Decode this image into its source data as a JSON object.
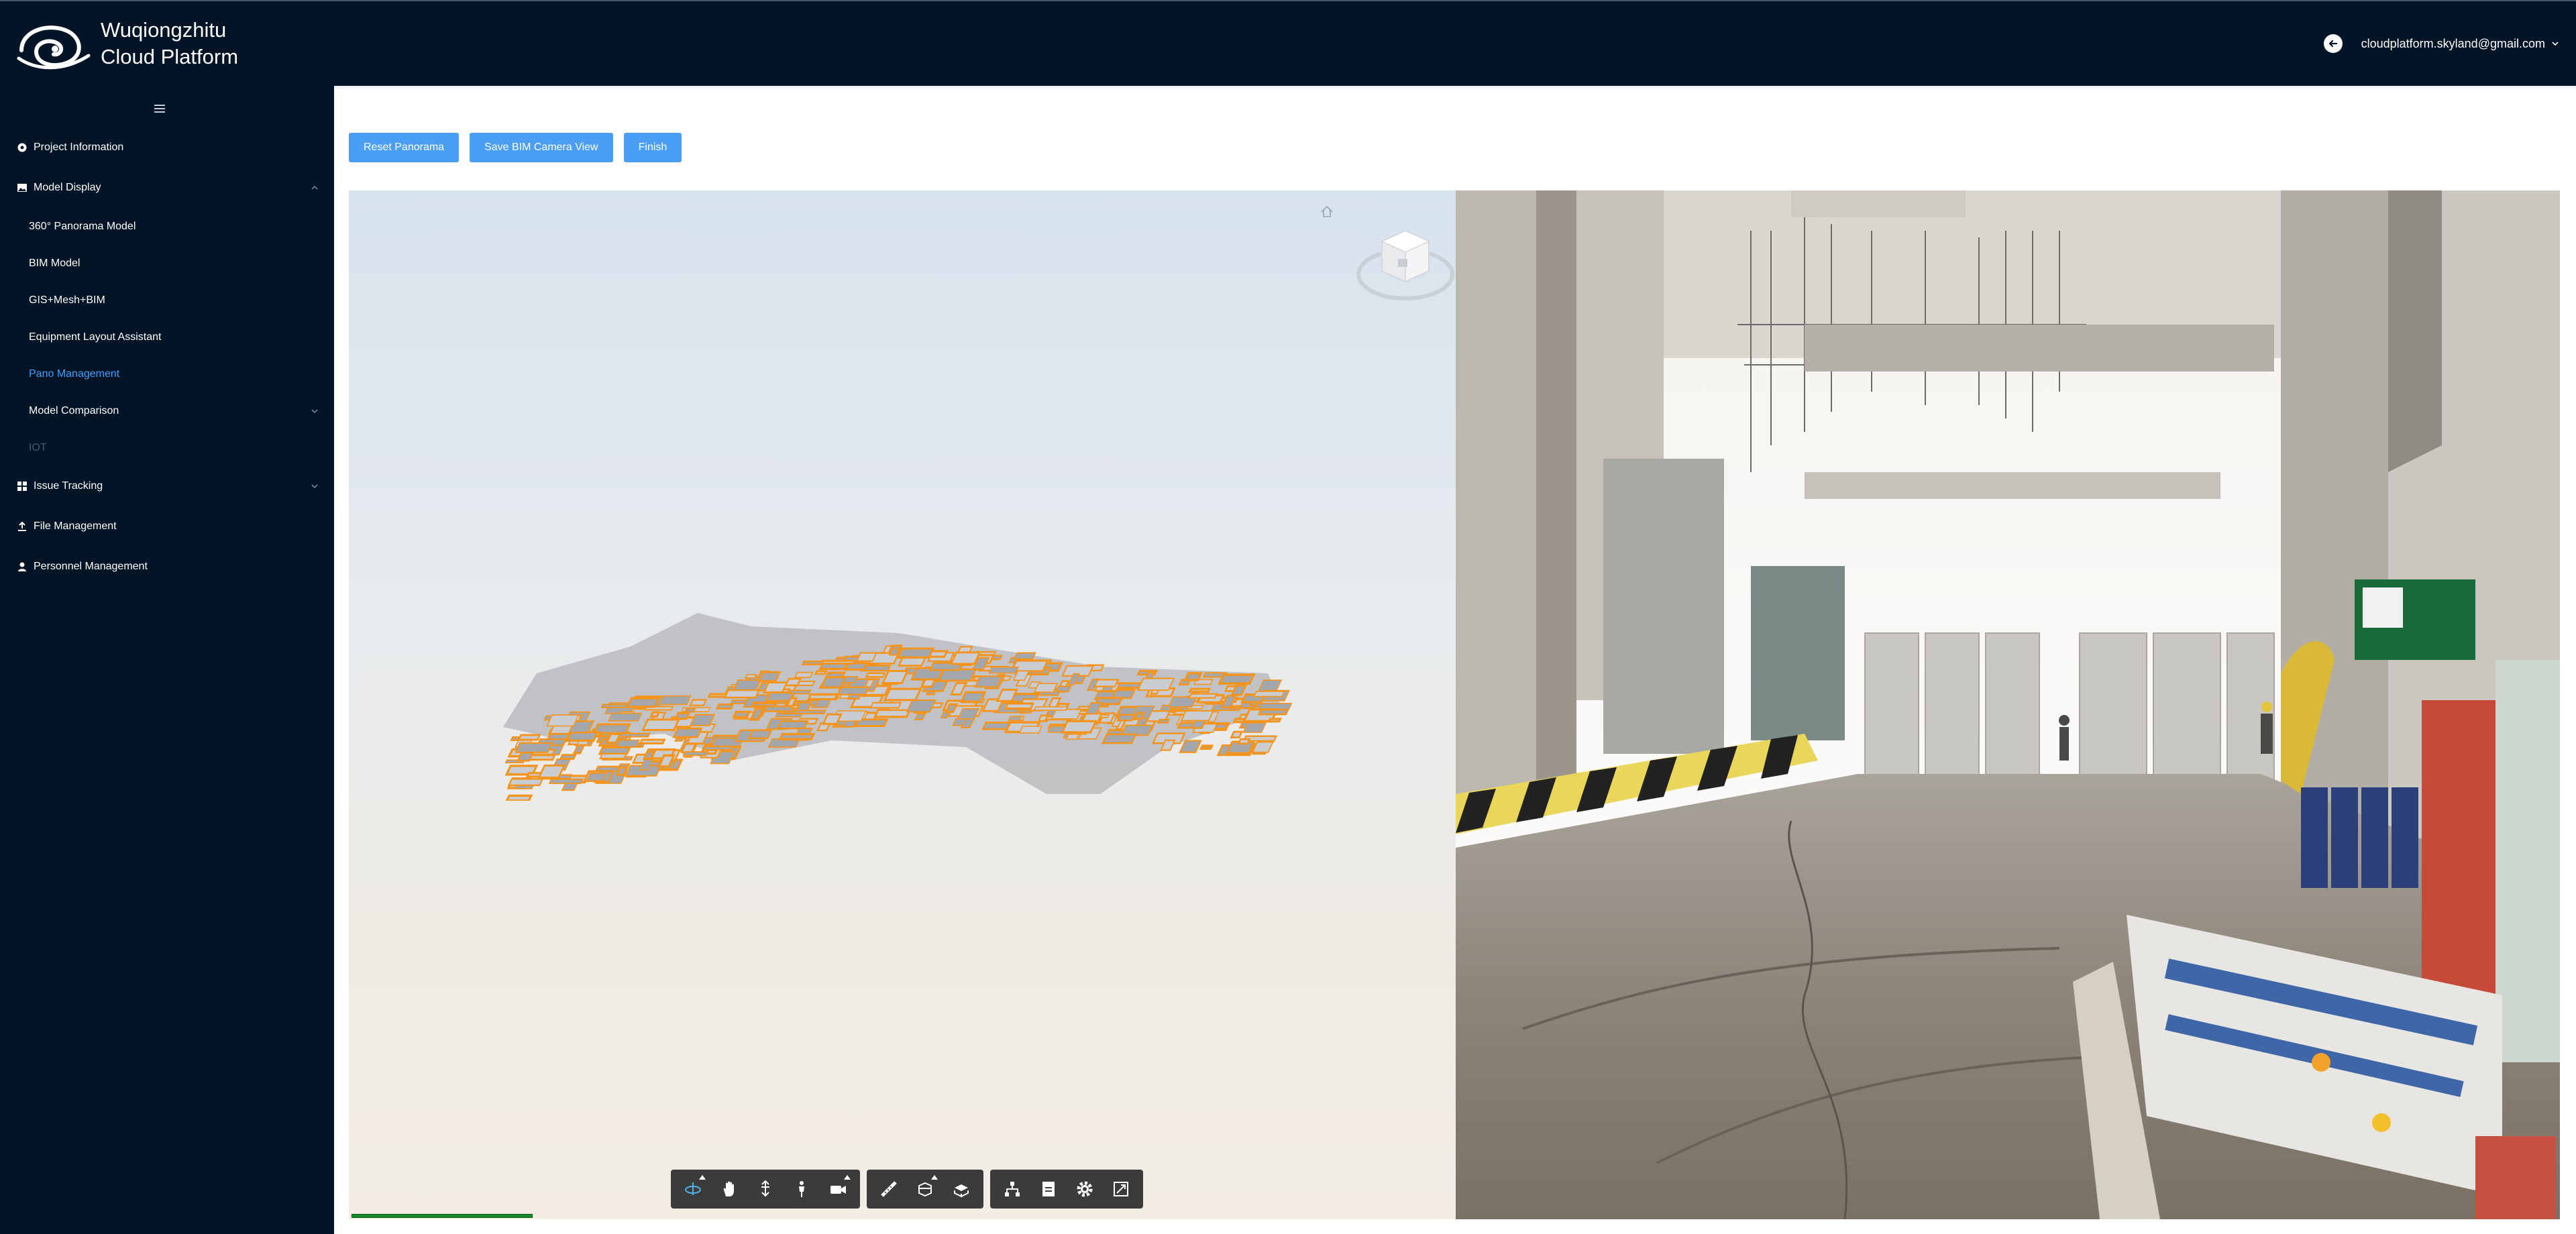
{
  "app": {
    "title_line1": "Wuqiongzhitu",
    "title_line2": "Cloud Platform",
    "user_email": "cloudplatform.skyland@gmail.com"
  },
  "sidebar": {
    "items": [
      {
        "label": "Project Information",
        "icon": "gear-icon"
      },
      {
        "label": "Model Display",
        "icon": "image-icon",
        "expanded": true
      },
      {
        "label": "360° Panorama Model"
      },
      {
        "label": "BIM Model"
      },
      {
        "label": "GIS+Mesh+BIM"
      },
      {
        "label": "Equipment Layout Assistant"
      },
      {
        "label": "Pano Management",
        "active": true
      },
      {
        "label": "Model Comparison"
      },
      {
        "label": "IOT",
        "disabled": true
      },
      {
        "label": "Issue Tracking",
        "icon": "grid-icon"
      },
      {
        "label": "File Management",
        "icon": "upload-icon"
      },
      {
        "label": "Personnel Management",
        "icon": "user-icon"
      }
    ]
  },
  "toolbar": {
    "reset_label": "Reset Panorama",
    "save_label": "Save BIM Camera View",
    "finish_label": "Finish"
  },
  "viewer": {
    "tools": [
      "orbit-icon",
      "pan-icon",
      "zoom-icon",
      "first-person-icon",
      "camera-icon",
      "measure-icon",
      "section-icon",
      "explode-icon",
      "model-browser-icon",
      "properties-icon",
      "settings-icon",
      "fullscreen-icon"
    ],
    "accent_color": "#f4941c"
  },
  "colors": {
    "header_bg": "#031427",
    "button_bg": "#4a9ff5",
    "active_link": "#409eff"
  }
}
